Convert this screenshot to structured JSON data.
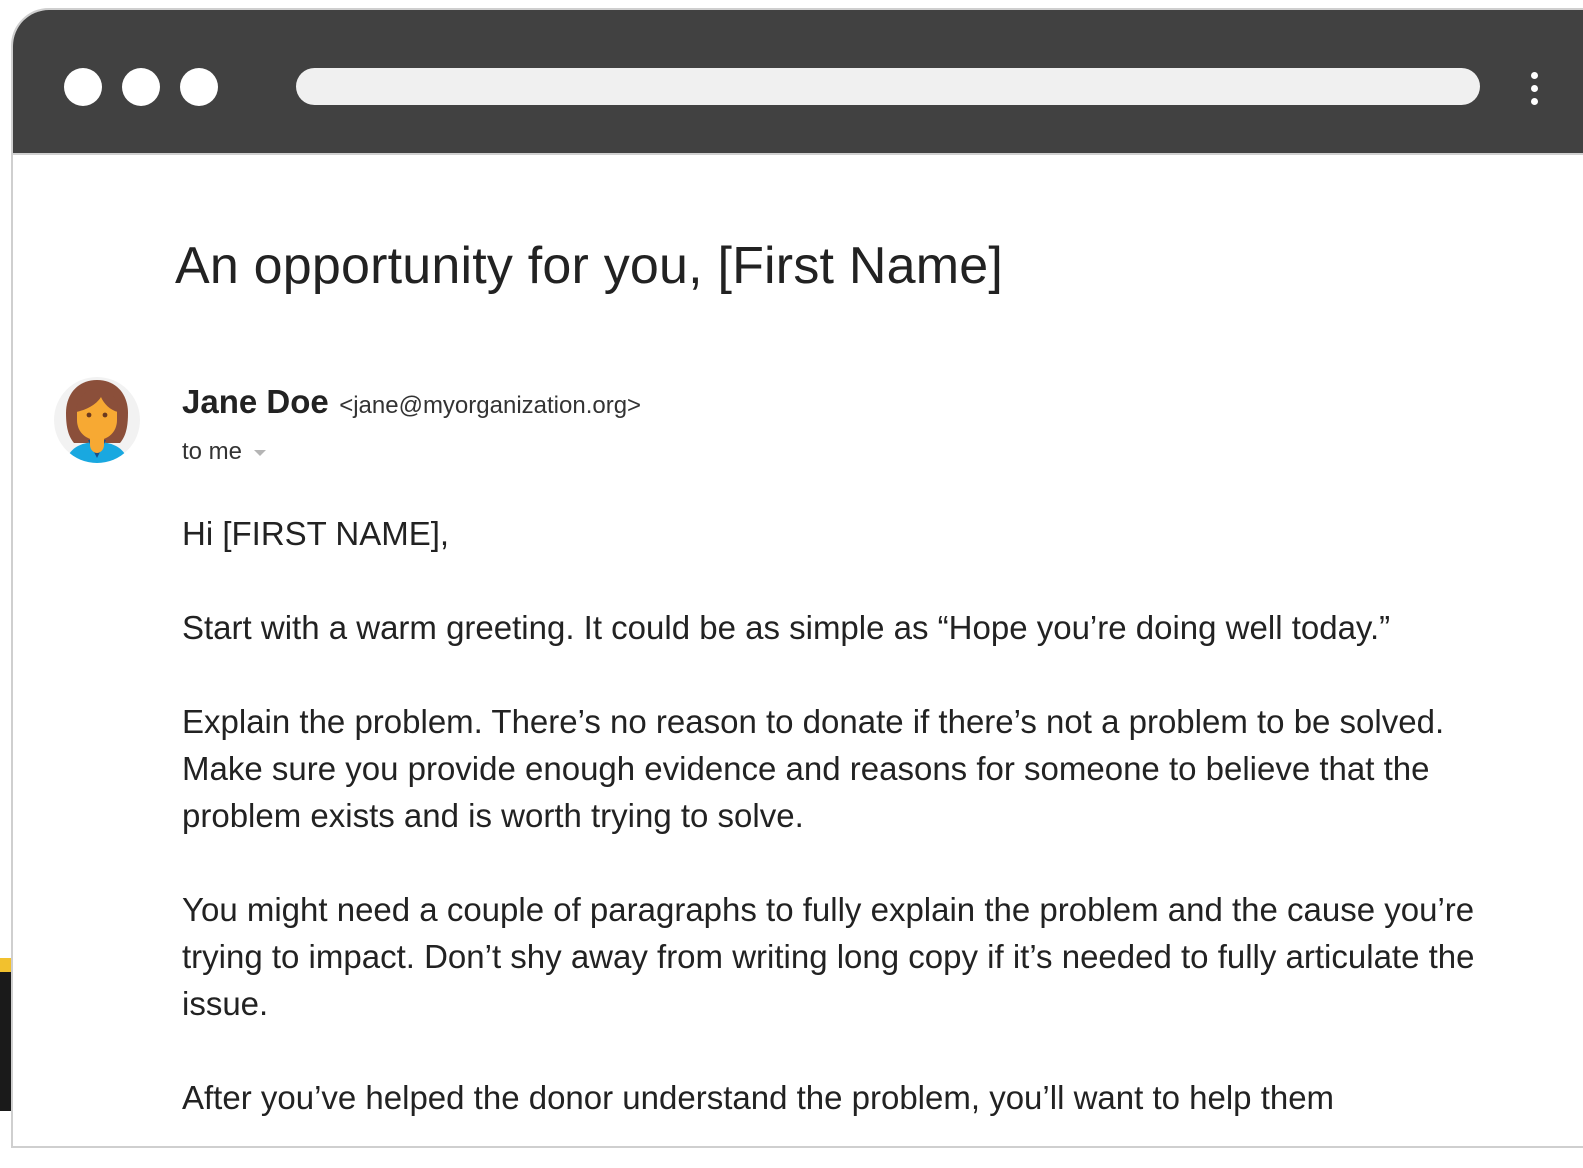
{
  "browser": {
    "window_controls": [
      "close",
      "minimize",
      "maximize"
    ],
    "address_value": "",
    "menu_icon": "kebab-menu-icon"
  },
  "email": {
    "subject": "An opportunity for you, [First Name]",
    "sender": {
      "name": "Jane Doe",
      "email": "<jane@myorganization.org>",
      "avatar_icon": "woman-avatar-icon"
    },
    "recipient_label": "to me",
    "body": [
      "Hi [FIRST NAME],",
      "Start with a warm greeting. It could be as simple as “Hope you’re doing well today.”",
      "Explain the problem. There’s no reason to donate if there’s not a problem to be solved. Make sure you provide enough evidence and reasons for someone to believe that the problem exists and is worth trying to solve.",
      "You might need a couple of paragraphs to fully explain the problem and the cause you’re trying to impact. Don’t shy away from writing long copy if it’s needed to fully articulate the issue.",
      "After you’ve helped the donor understand the problem, you’ll want to help them"
    ]
  },
  "colors": {
    "titlebar": "#414141",
    "address_bar": "#f0f0f0",
    "text": "#222222",
    "avatar_hair": "#8b4f3a",
    "avatar_skin": "#f7a933",
    "avatar_shirt": "#19a8e0",
    "accent_stripe": "#f2c12e"
  }
}
